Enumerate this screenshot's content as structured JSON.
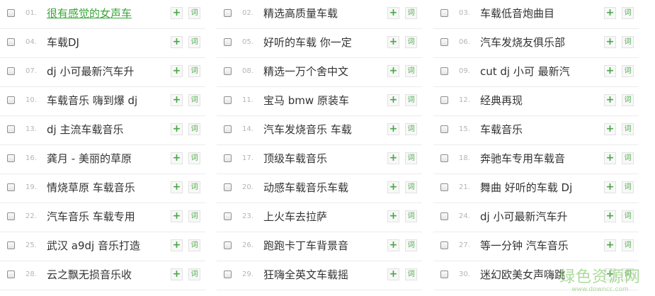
{
  "buttons": {
    "add_label": "+",
    "lyric_label": "词"
  },
  "columns": [
    [
      {
        "num": "01.",
        "title": "很有感觉的女声车"
      },
      {
        "num": "04.",
        "title": "车载DJ"
      },
      {
        "num": "07.",
        "title": "dj 小可最新汽车升"
      },
      {
        "num": "10.",
        "title": "车载音乐 嗨到爆 dj"
      },
      {
        "num": "13.",
        "title": "dj 主流车载音乐"
      },
      {
        "num": "16.",
        "title": "龚月 - 美丽的草原"
      },
      {
        "num": "19.",
        "title": "情烧草原 车载音乐"
      },
      {
        "num": "22.",
        "title": "汽车音乐 车载专用"
      },
      {
        "num": "25.",
        "title": "武汉 a9dj 音乐打造"
      },
      {
        "num": "28.",
        "title": "云之飘无损音乐收"
      }
    ],
    [
      {
        "num": "02.",
        "title": "精选高质量车载"
      },
      {
        "num": "05.",
        "title": "好听的车载 你一定"
      },
      {
        "num": "08.",
        "title": "精选一万个舍中文"
      },
      {
        "num": "11.",
        "title": "宝马 bmw 原装车"
      },
      {
        "num": "14.",
        "title": "汽车发烧音乐 车载"
      },
      {
        "num": "17.",
        "title": "顶级车载音乐"
      },
      {
        "num": "20.",
        "title": "动感车载音乐车载"
      },
      {
        "num": "23.",
        "title": "上火车去拉萨"
      },
      {
        "num": "26.",
        "title": "跑跑卡丁车背景音"
      },
      {
        "num": "29.",
        "title": "狂嗨全英文车载摇"
      }
    ],
    [
      {
        "num": "03.",
        "title": "车载低音炮曲目"
      },
      {
        "num": "06.",
        "title": "汽车发烧友俱乐部"
      },
      {
        "num": "09.",
        "title": "cut dj 小可 最新汽"
      },
      {
        "num": "12.",
        "title": "经典再现"
      },
      {
        "num": "15.",
        "title": "车载音乐"
      },
      {
        "num": "18.",
        "title": "奔驰车专用车载音"
      },
      {
        "num": "21.",
        "title": "舞曲 好听的车载 Dj"
      },
      {
        "num": "24.",
        "title": "dj 小可最新汽车升"
      },
      {
        "num": "27.",
        "title": "等一分钟 汽车音乐"
      },
      {
        "num": "30.",
        "title": "迷幻欧美女声嗨跳"
      }
    ]
  ],
  "watermark": {
    "main": "绿色资源网",
    "sub": "www.downcc.com"
  }
}
